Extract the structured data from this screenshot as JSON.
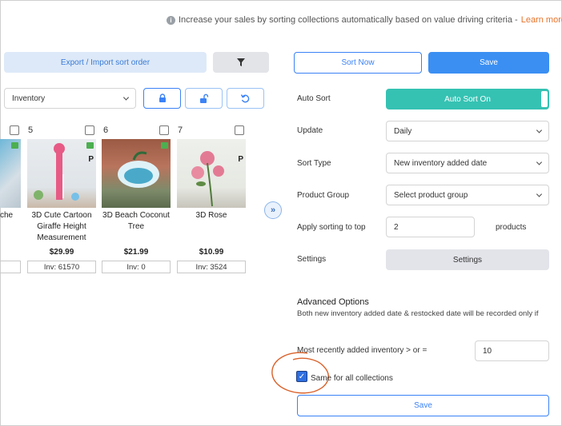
{
  "info": {
    "message": "Increase your sales by sorting collections automatically based on value driving criteria -",
    "learn_more": "Learn more"
  },
  "toolbar": {
    "export_label": "Export / Import sort order",
    "sort_now_label": "Sort Now",
    "save_label": "Save"
  },
  "left": {
    "inventory_select": "Inventory",
    "cards": [
      {
        "number": "",
        "name": "che",
        "price": "",
        "inv": ""
      },
      {
        "number": "5",
        "name": "3D Cute Cartoon Giraffe Height Measurement",
        "price": "$29.99",
        "inv": "Inv: 61570"
      },
      {
        "number": "6",
        "name": "3D Beach Coconut Tree",
        "price": "$21.99",
        "inv": "Inv: 0"
      },
      {
        "number": "7",
        "name": "3D Rose",
        "price": "$10.99",
        "inv": "Inv: 3524"
      }
    ],
    "badge_letter": "P"
  },
  "settings": {
    "auto_sort_label": "Auto Sort",
    "auto_sort_value": "Auto Sort On",
    "update_label": "Update",
    "update_value": "Daily",
    "sort_type_label": "Sort Type",
    "sort_type_value": "New inventory added date",
    "product_group_label": "Product Group",
    "product_group_value": "Select product group",
    "apply_top_label": "Apply sorting to top",
    "apply_top_value": "2",
    "apply_top_unit": "products",
    "settings_label": "Settings",
    "settings_button": "Settings"
  },
  "advanced": {
    "title": "Advanced Options",
    "description": "Both new inventory added date & restocked date will be recorded only if",
    "recent_label": "Most recently added inventory > or =",
    "recent_value": "10",
    "same_for_all_label": "Same for all collections",
    "same_for_all_checked": true,
    "save_label": "Save"
  },
  "colors": {
    "accent_blue": "#3b8ff3",
    "teal": "#35c2b3",
    "link_orange": "#e8732a",
    "annotation_circle": "#d9622b"
  }
}
